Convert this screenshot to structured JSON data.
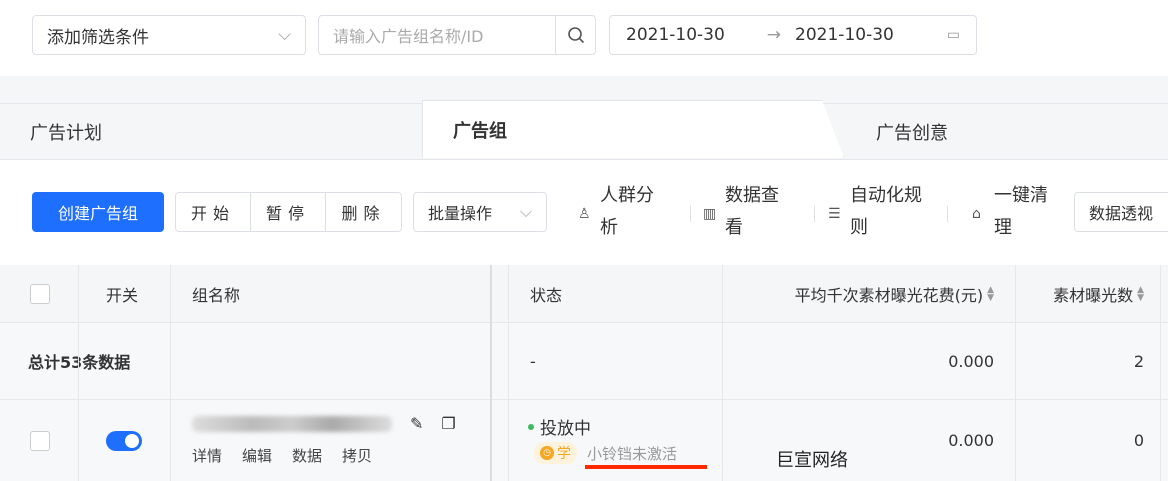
{
  "filter": {
    "select_label": "添加筛选条件",
    "search_placeholder": "请输入广告组名称/ID",
    "date_start": "2021-10-30",
    "date_sep": "→",
    "date_end": "2021-10-30"
  },
  "tabs": [
    {
      "label": "广告计划"
    },
    {
      "label": "广告组",
      "active": true
    },
    {
      "label": "广告创意"
    }
  ],
  "toolbar": {
    "create": "创建广告组",
    "start": "开始",
    "pause": "暂停",
    "delete": "删除",
    "batch": "批量操作",
    "crowd": [
      "人群分",
      "析"
    ],
    "data": [
      "数据查",
      "看"
    ],
    "auto": [
      "自动化规",
      "则"
    ],
    "clean": [
      "一键清",
      "理"
    ],
    "pivot": "数据透视"
  },
  "table": {
    "headers": [
      "开关",
      "组名称",
      "状态",
      "平均千次素材曝光花费(元)",
      "素材曝光数"
    ],
    "summary": {
      "label": "总计53条数据",
      "status": "-",
      "cpm": "0.000",
      "impressions": "2"
    },
    "rows": [
      {
        "actions": [
          "详情",
          "编辑",
          "数据",
          "拷贝"
        ],
        "status": "投放中",
        "tag": "学",
        "note": "小铃铛未激活",
        "cpm": "0.000",
        "impressions": "0"
      }
    ]
  },
  "watermark": "巨宣网络",
  "colors": {
    "primary": "#1f6fff",
    "status_ok": "#3cba5c",
    "tag": "#f5a623",
    "underline": "#ff2a00"
  }
}
